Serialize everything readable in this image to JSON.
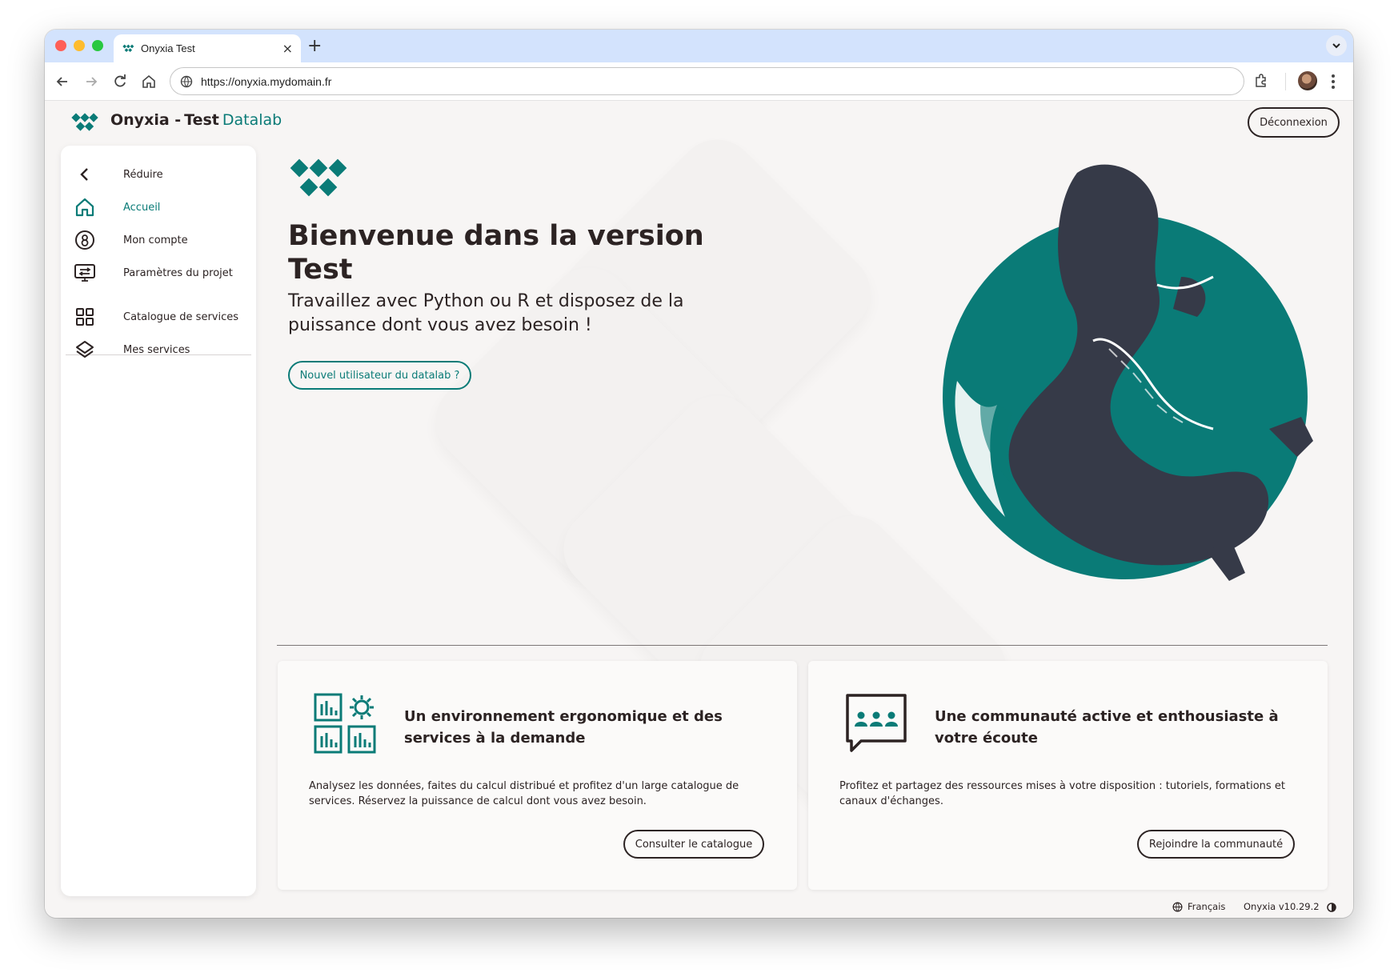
{
  "browser": {
    "tab_title": "Onyxia Test",
    "new_tab_symbol": "+",
    "close_symbol": "×",
    "url": "https://onyxia.mydomain.fr"
  },
  "header": {
    "brand": "Onyxia -",
    "instance": "Test",
    "suffix": "Datalab",
    "logout_label": "Déconnexion"
  },
  "sidebar": {
    "items": [
      {
        "label": "Réduire",
        "icon": "chevron-left-icon"
      },
      {
        "label": "Accueil",
        "icon": "home-icon"
      },
      {
        "label": "Mon compte",
        "icon": "account-icon"
      },
      {
        "label": "Paramètres du projet",
        "icon": "project-settings-icon"
      },
      {
        "label": "Catalogue de services",
        "icon": "grid-icon"
      },
      {
        "label": "Mes services",
        "icon": "layers-icon"
      }
    ]
  },
  "hero": {
    "title": "Bienvenue dans la version Test",
    "subtitle": "Travaillez avec Python ou R et disposez de la puissance dont vous avez besoin !",
    "button_label": "Nouvel utilisateur du datalab ?"
  },
  "cards": [
    {
      "title": "Un environnement ergonomique et des services à la demande",
      "text": "Analysez les données, faites du calcul distribué et profitez d'un large catalogue de services. Réservez la puissance de calcul dont vous avez besoin.",
      "button_label": "Consulter le catalogue",
      "icon": "services-dashboard-icon"
    },
    {
      "title": "Une communauté active et enthousiaste à votre écoute",
      "text": "Profitez et partagez des ressources mises à votre disposition : tutoriels, formations et canaux d'échanges.",
      "button_label": "Rejoindre la communauté",
      "icon": "community-chat-icon"
    }
  ],
  "footer": {
    "language": "Français",
    "version": "Onyxia v10.29.2"
  },
  "colors": {
    "accent": "#0a7b77",
    "text": "#2c2323",
    "background": "#f7f5f4"
  }
}
